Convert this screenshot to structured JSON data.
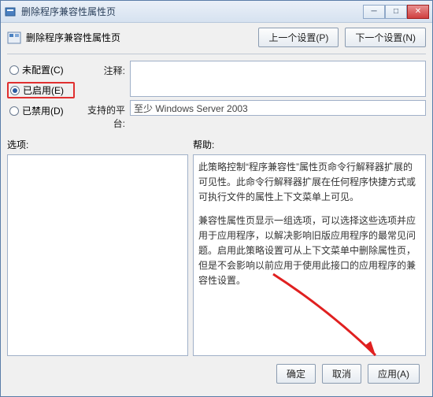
{
  "window": {
    "title": "删除程序兼容性属性页"
  },
  "header": {
    "label": "删除程序兼容性属性页",
    "prev_btn": "上一个设置(P)",
    "next_btn": "下一个设置(N)"
  },
  "radios": {
    "not_configured": "未配置(C)",
    "enabled": "已启用(E)",
    "disabled": "已禁用(D)",
    "selected": "enabled"
  },
  "config": {
    "comment_label": "注释:",
    "comment_value": "",
    "platform_label": "支持的平台:",
    "platform_value": "至少 Windows Server 2003"
  },
  "sections": {
    "options": "选项:",
    "help": "帮助:"
  },
  "help": {
    "p1": "此策略控制“程序兼容性”属性页命令行解释器扩展的可见性。此命令行解释器扩展在任何程序快捷方式或可执行文件的属性上下文菜单上可见。",
    "p2": "兼容性属性页显示一组选项，可以选择这些选项并应用于应用程序，以解决影响旧版应用程序的最常见问题。启用此策略设置可从上下文菜单中删除属性页，但是不会影响以前应用于使用此接口的应用程序的兼容性设置。"
  },
  "footer": {
    "ok": "确定",
    "cancel": "取消",
    "apply": "应用(A)"
  }
}
